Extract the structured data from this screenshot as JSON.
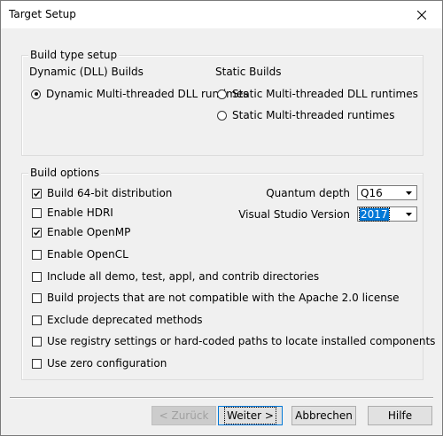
{
  "window": {
    "title": "Target Setup"
  },
  "build_type": {
    "legend": "Build type setup",
    "dynamic_heading": "Dynamic (DLL) Builds",
    "static_heading": "Static Builds",
    "options": [
      {
        "label": "Dynamic Multi-threaded DLL runtimes",
        "selected": true
      },
      {
        "label": "Static Multi-threaded DLL runtimes",
        "selected": false
      },
      {
        "label": "Static Multi-threaded runtimes",
        "selected": false
      }
    ]
  },
  "build_options": {
    "legend": "Build options",
    "checks": [
      {
        "label": "Build 64-bit distribution",
        "checked": true
      },
      {
        "label": "Enable HDRI",
        "checked": false
      },
      {
        "label": "Enable OpenMP",
        "checked": true
      },
      {
        "label": "Enable OpenCL",
        "checked": false
      },
      {
        "label": "Include all demo, test, appl, and contrib directories",
        "checked": false
      },
      {
        "label": "Build projects that are not compatible with the Apache 2.0 license",
        "checked": false
      },
      {
        "label": "Exclude deprecated methods",
        "checked": false
      },
      {
        "label": "Use registry settings or hard-coded paths to locate installed components",
        "checked": false
      },
      {
        "label": "Use zero configuration",
        "checked": false
      }
    ],
    "quantum_label": "Quantum depth",
    "quantum_value": "Q16",
    "vs_label": "Visual Studio Version",
    "vs_value": "2017"
  },
  "buttons": {
    "back": "< Zurück",
    "next": "Weiter >",
    "cancel": "Abbrechen",
    "help": "Hilfe"
  }
}
